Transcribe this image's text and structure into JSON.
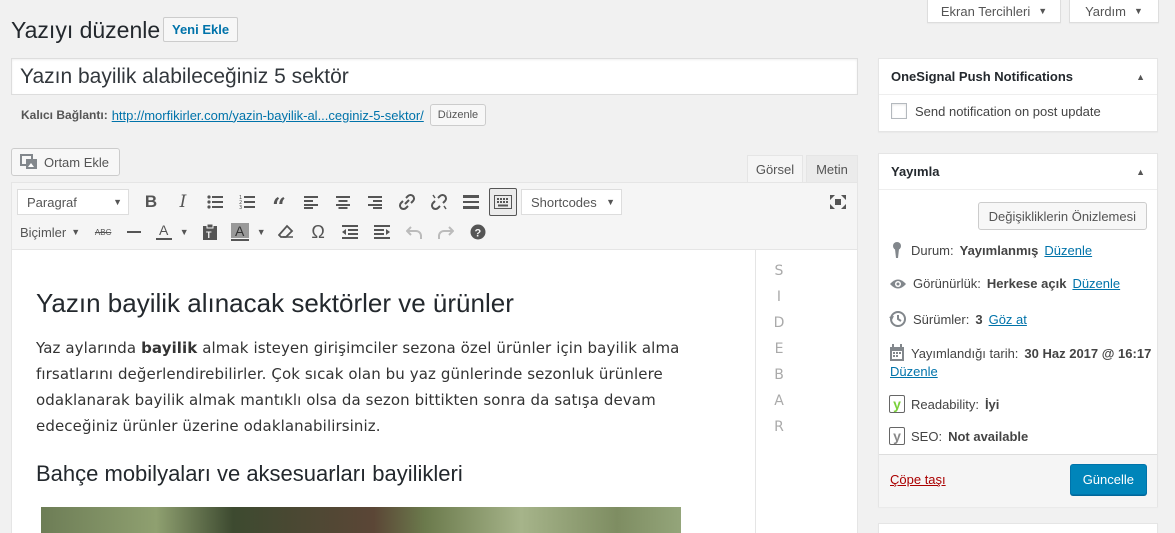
{
  "screen_options": {
    "label": "Ekran Tercihleri"
  },
  "help": {
    "label": "Yardım"
  },
  "page": {
    "title": "Yazıyı düzenle",
    "add_new": "Yeni Ekle"
  },
  "post": {
    "title": "Yazın bayilik alabileceğiniz 5 sektör",
    "permalink_label": "Kalıcı Bağlantı:",
    "permalink_url": "http://morfikirler.com/yazin-bayilik-al...ceginiz-5-sektor/",
    "permalink_edit": "Düzenle"
  },
  "media": {
    "add_media": "Ortam Ekle"
  },
  "editor_tabs": {
    "visual": "Görsel",
    "text": "Metin"
  },
  "toolbar": {
    "format_select": "Paragraf",
    "shortcodes": "Shortcodes",
    "styles": "Biçimler",
    "strikethrough_text": "ABC"
  },
  "content": {
    "heading": "Yazın bayilik alınacak sektörler ve ürünler",
    "para_before": "Yaz aylarında ",
    "para_bold": "bayilik",
    "para_after": " almak isteyen girişimciler sezona özel ürünler için bayilik alma fırsatlarını değerlendirebilirler. Çok sıcak olan bu yaz günlerinde sezonluk ürünlere odaklanarak bayilik almak mantıklı olsa da sezon bittikten sonra da satışa devam edeceğiniz ürünler üzerine odaklanabilirsiniz.",
    "subheading": "Bahçe mobilyaları ve aksesuarları bayilikleri"
  },
  "sidebar_letters": [
    "S",
    "I",
    "D",
    "E",
    "B",
    "A",
    "R"
  ],
  "onesignal": {
    "title": "OneSignal Push Notifications",
    "checkbox_label": "Send notification on post update"
  },
  "publish": {
    "title": "Yayımla",
    "preview": "Değişikliklerin Önizlemesi",
    "status_label": "Durum:",
    "status_value": "Yayımlanmış",
    "status_edit": "Düzenle",
    "visibility_label": "Görünürlük:",
    "visibility_value": "Herkese açık",
    "visibility_edit": "Düzenle",
    "revisions_label": "Sürümler:",
    "revisions_value": "3",
    "revisions_link": "Göz at",
    "date_label": "Yayımlandığı tarih:",
    "date_value": "30 Haz 2017 @ 16:17",
    "date_edit": "Düzenle",
    "readability_label": "Readability:",
    "readability_value": "İyi",
    "seo_label": "SEO:",
    "seo_value": "Not available",
    "trash": "Çöpe taşı",
    "update": "Güncelle"
  },
  "colors": {
    "primary": "#0085ba",
    "link": "#0073aa",
    "trash": "#aa0000",
    "yoast_good": "#7ad03a"
  }
}
